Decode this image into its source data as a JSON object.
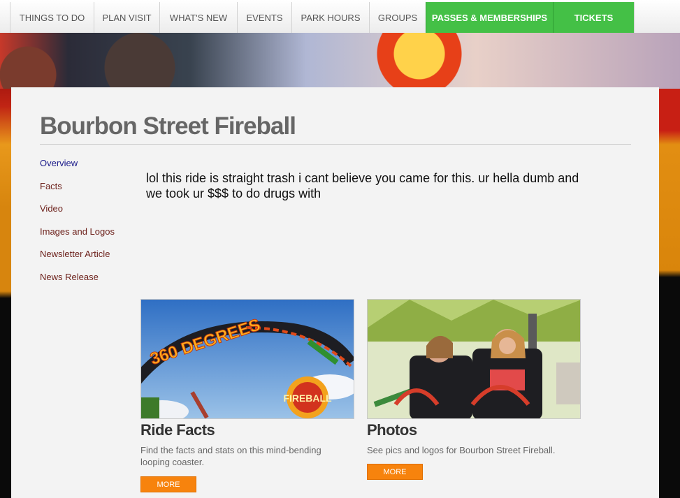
{
  "nav": {
    "items": [
      {
        "label": "THINGS TO DO"
      },
      {
        "label": "PLAN VISIT"
      },
      {
        "label": "WHAT'S NEW"
      },
      {
        "label": "EVENTS"
      },
      {
        "label": "PARK HOURS"
      },
      {
        "label": "GROUPS"
      },
      {
        "label": "PASSES & MEMBERSHIPS"
      },
      {
        "label": "TICKETS"
      }
    ],
    "highlight_color": "#44c046"
  },
  "page": {
    "title": "Bourbon Street Fireball",
    "message": "lol this ride is straight trash i cant believe you came for this. ur hella dumb and we took ur $$$ to do drugs with"
  },
  "sidenav": {
    "items": [
      {
        "label": "Overview",
        "active": true
      },
      {
        "label": "Facts"
      },
      {
        "label": "Video"
      },
      {
        "label": "Images and Logos"
      },
      {
        "label": "Newsletter Article"
      },
      {
        "label": "News Release"
      }
    ]
  },
  "cards": [
    {
      "image_text": "360 DEGREES",
      "logo_text": "FIREBALL",
      "heading": "Ride Facts",
      "description": "Find the facts and stats on this mind-bending looping coaster.",
      "button": "MORE"
    },
    {
      "heading": "Photos",
      "description": "See pics and logos for Bourbon Street Fireball.",
      "button": "MORE"
    }
  ],
  "colors": {
    "button": "#f7830d",
    "link": "#6b1f19",
    "active_link": "#1b1b8a"
  }
}
